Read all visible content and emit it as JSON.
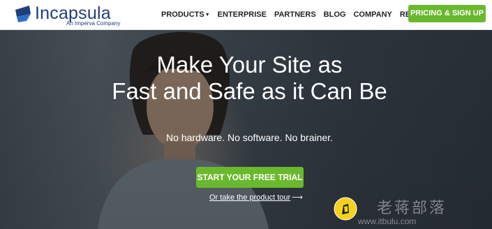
{
  "brand": {
    "name": "Incapsula",
    "tagline": "An Imperva Company",
    "color": "#1f3f7a"
  },
  "nav": {
    "items": [
      {
        "label": "PRODUCTS",
        "has_dropdown": true
      },
      {
        "label": "ENTERPRISE",
        "has_dropdown": false
      },
      {
        "label": "PARTNERS",
        "has_dropdown": false
      },
      {
        "label": "BLOG",
        "has_dropdown": false
      },
      {
        "label": "COMPANY",
        "has_dropdown": false
      },
      {
        "label": "RESOURCES",
        "has_dropdown": false
      }
    ],
    "cta_label": "PRICING & SIGN UP"
  },
  "hero": {
    "title_line1": "Make Your Site as",
    "title_line2": "Fast and Safe as it Can Be",
    "subtitle": "No hardware. No software. No brainer.",
    "cta_label": "START YOUR FREE TRIAL",
    "tour_link": "Or take the product tour",
    "tour_icon": "arrow-right-icon"
  },
  "watermark": {
    "chinese_text": "老蒋部落",
    "url": "www.itbulu.com",
    "icon": "pencil-badge-icon"
  },
  "colors": {
    "accent_green": "#6ab82e",
    "header_bg": "#ffffff",
    "hero_bg": "#3a424a"
  }
}
